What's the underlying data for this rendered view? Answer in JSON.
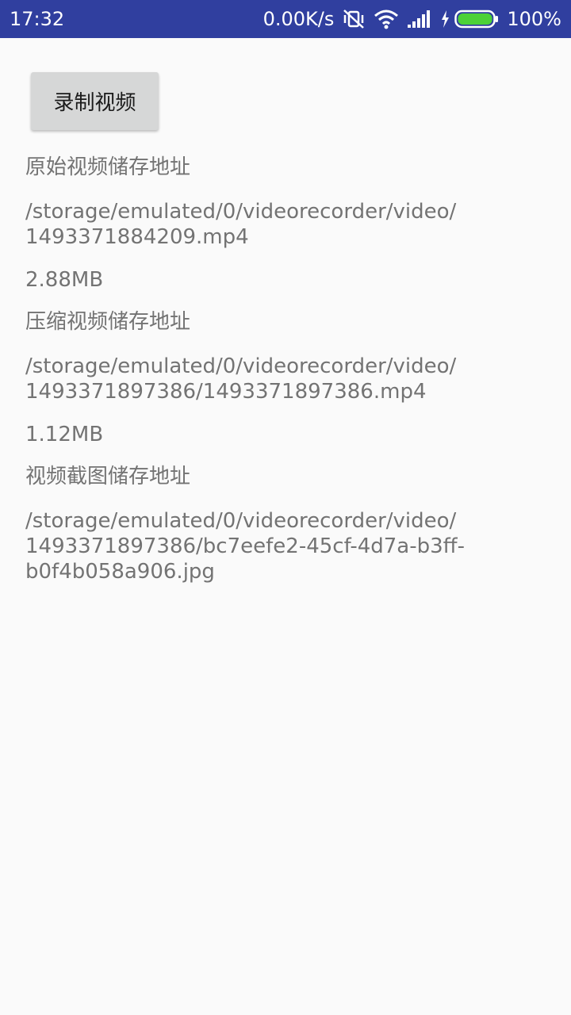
{
  "status_bar": {
    "time": "17:32",
    "net_speed": "0.00K/s",
    "battery_percent": "100%",
    "battery_level": 1.0,
    "icons": [
      "mute-vibrate-icon",
      "wifi-icon",
      "signal-icon",
      "charging-icon",
      "battery-icon"
    ]
  },
  "main": {
    "record_button_label": "录制视频",
    "original_video": {
      "label": "原始视频储存地址",
      "path_line1": "/storage/emulated/0/videorecorder/video/",
      "path_line2": "1493371884209.mp4",
      "size": "2.88MB"
    },
    "compressed_video": {
      "label": "压缩视频储存地址",
      "path_line1": "/storage/emulated/0/videorecorder/video/",
      "path_line2": "1493371897386/1493371897386.mp4",
      "size": "1.12MB"
    },
    "screenshot": {
      "label": "视频截图储存地址",
      "path_line1": "/storage/emulated/0/videorecorder/video/",
      "path_line2": "1493371897386/bc7eefe2-45cf-4d7a-b3ff-",
      "path_line3": "b0f4b058a906.jpg"
    }
  },
  "colors": {
    "status_bar": "#303f9f",
    "background": "#fafafa",
    "text": "#737373",
    "button": "#d6d7d7",
    "battery_fill": "#4cd137"
  }
}
